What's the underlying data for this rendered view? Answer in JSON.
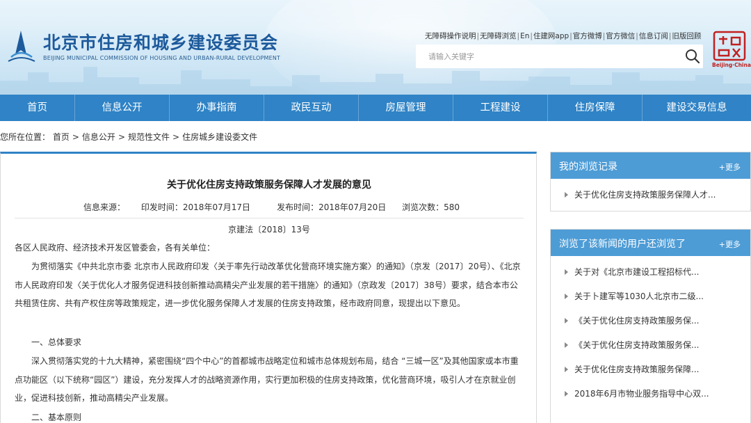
{
  "header": {
    "title_cn": "北京市住房和城乡建设委员会",
    "title_en": "BEIJING MUNICIPAL COMMISSION OF HOUSING AND URBAN-RURAL DEVELOPMENT",
    "top_links": [
      "无障碍操作说明",
      "无障碍浏览",
      "En",
      "住建网app",
      "官方微博",
      "官方微信",
      "信息订阅",
      "旧版回顾"
    ],
    "search_placeholder": "请输入关键字",
    "seal_text": "Beijing·China"
  },
  "nav": {
    "items": [
      "首页",
      "信息公开",
      "办事指南",
      "政民互动",
      "房屋管理",
      "工程建设",
      "住房保障",
      "建设交易信息"
    ]
  },
  "breadcrumb": {
    "prefix": "您所在位置：",
    "items": [
      "首页",
      "信息公开",
      "规范性文件",
      "住房城乡建设委文件"
    ],
    "separator": ">"
  },
  "article": {
    "title": "关于优化住房支持政策服务保障人才发展的意见",
    "source": "信息来源：",
    "issue_date": "印发时间：2018年07月17日",
    "publish_date": "发布时间：2018年07月20日",
    "views": "浏览次数：580",
    "doc_no": "京建法〔2018〕13号",
    "salutation": "各区人民政府、经济技术开发区管委会，各有关单位：",
    "para1": "为贯彻落实《中共北京市委 北京市人民政府印发〈关于率先行动改革优化营商环境实施方案〉的通知》（京发〔2017〕20号）、《北京市人民政府印发〈关于优化人才服务促进科技创新推动高精尖产业发展的若干措施〉的通知》（京政发〔2017〕38号）要求，结合本市公共租赁住房、共有产权住房等政策规定，进一步优化服务保障人才发展的住房支持政策，经市政府同意，现提出以下意见。",
    "heading1": "一、总体要求",
    "para2": "深入贯彻落实党的十九大精神，紧密围绕“四个中心”的首都城市战略定位和城市总体规划布局，结合 “三城一区”及其他国家或本市重点功能区（以下统称“园区”）建设，充分发挥人才的战略资源作用，实行更加积极的住房支持政策，优化营商环境，吸引人才在京就业创业，促进科技创新，推动高精尖产业发展。",
    "heading2": "二、基本原则"
  },
  "sidebar": {
    "history": {
      "title": "我的浏览记录",
      "more": "+更多",
      "items": [
        "关于优化住房支持政策服务保障人才..."
      ]
    },
    "related": {
      "title": "浏览了该新闻的用户还浏览了",
      "more": "+更多",
      "items": [
        "关于对《北京市建设工程招标代...",
        "关于卜建军等1030人北京市二级...",
        "《关于优化住房支持政策服务保...",
        "《关于优化住房支持政策服务保...",
        "关于优化住房支持政策服务保障...",
        "2018年6月市物业服务指导中心双..."
      ]
    }
  },
  "colors": {
    "nav_bg": "#2f83c6",
    "sidebar_head": "#4d9cd6",
    "title_blue": "#1d5a9c"
  }
}
